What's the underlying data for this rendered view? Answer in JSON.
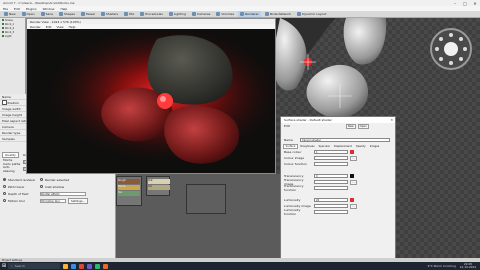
{
  "window": {
    "title": "Arnold 7 - C:\\Users\\...\\Desktop\\Arnold\\Rocks.ma",
    "min": "–",
    "max": "□",
    "close": "✕"
  },
  "menu": [
    "File",
    "Edit",
    "Plugins",
    "Window",
    "Help"
  ],
  "toolbar": [
    {
      "label": "New",
      "icon": "new-icon"
    },
    {
      "label": "Open",
      "icon": "open-icon"
    },
    {
      "label": "Save",
      "icon": "save-icon"
    },
    {
      "label": "Shapes",
      "icon": "shapes-icon"
    },
    {
      "label": "Tessel",
      "icon": "tessel-icon"
    },
    {
      "label": "Shaders",
      "icon": "shaders-icon"
    },
    {
      "label": "Mix",
      "icon": "mix-icon"
    },
    {
      "label": "Procedurals",
      "icon": "procedurals-icon"
    },
    {
      "label": "Lighting",
      "icon": "lighting-icon"
    },
    {
      "label": "Cameras",
      "icon": "camera-icon"
    },
    {
      "label": "Volumes",
      "icon": "volumes-icon"
    },
    {
      "label": "Renderer",
      "icon": "render-icon"
    },
    {
      "label": "Node Network",
      "icon": "node-icon"
    },
    {
      "label": "Dynamic Layout",
      "icon": "layout-icon"
    }
  ],
  "scene_tree": [
    "Scene",
    "Rock_1",
    "Rock_2",
    "Rock_3",
    "Light"
  ],
  "props": {
    "labels": [
      "Name",
      "Position",
      "Image width",
      "Image height",
      "Pixel aspect ratio",
      "Camera",
      "Render type",
      "Samples"
    ],
    "tabs": [
      "Quality",
      "Output",
      "Advanced"
    ],
    "mcpaths_label": "Monte Carlo paths",
    "mcpaths_value": "16.0",
    "antialias_label": "Anti-aliasing",
    "antialias_value": "3",
    "edit_btn": "Edit",
    "sampling_btn": "Edit Sampling...",
    "modes": [
      {
        "label": "Standard renderer",
        "on": true
      },
      {
        "label": "Path tracer",
        "on": false
      },
      {
        "label": "Depth of field",
        "on": false
      },
      {
        "label": "Motion blur",
        "on": false
      }
    ],
    "modes_right": [
      "Render selected",
      "Cast shadow",
      "Shutter effects",
      "3D motion blur"
    ],
    "settings_btn": "Settings...",
    "status": "Project settings"
  },
  "render_window": {
    "title": "Render View - 1024 x 576 (100%)",
    "menu": [
      "Render",
      "Edit",
      "View",
      "Help"
    ]
  },
  "material_dialog": {
    "title": "Surface shader - Default shader",
    "close": "✕",
    "edit_label": "Edit",
    "btn_new": "New",
    "btn_open": "Open",
    "name_label": "Name",
    "name_value": "Canyon shader",
    "tabs": [
      "Surface",
      "Roughness",
      "Specular",
      "Displacement",
      "Opacity",
      "Images"
    ],
    "rows": [
      {
        "label": "Base colour",
        "value": "1"
      },
      {
        "label": "Colour image",
        "value": ""
      },
      {
        "label": "Colour function",
        "value": ""
      },
      {
        "label": "Translucency",
        "value": "0"
      },
      {
        "label": "Translucency image",
        "value": ""
      },
      {
        "label": "Translucency function",
        "value": ""
      },
      {
        "label": "Luminosity",
        "value": "20"
      },
      {
        "label": "Luminosity image",
        "value": ""
      },
      {
        "label": "Luminosity function",
        "value": ""
      }
    ],
    "accent": "#d83030"
  },
  "node_editor": {
    "node_a": [
      "Rough",
      "Bump",
      "Tex"
    ],
    "node_b": [
      "Out",
      "Col"
    ]
  },
  "taskbar": {
    "search": "Search",
    "weather": "9°C  Storm incoming",
    "time": "22:08",
    "date": "21-10-2024"
  }
}
